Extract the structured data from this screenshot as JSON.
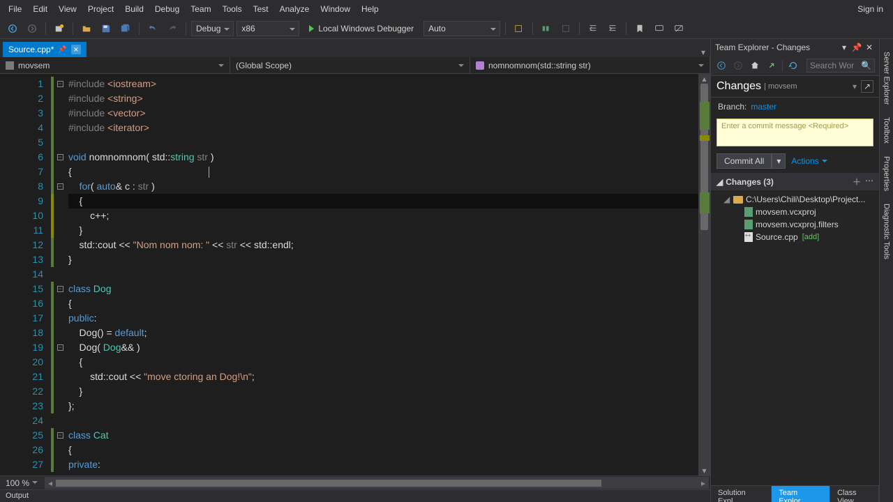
{
  "menu": {
    "items": [
      "File",
      "Edit",
      "View",
      "Project",
      "Build",
      "Debug",
      "Team",
      "Tools",
      "Test",
      "Analyze",
      "Window",
      "Help"
    ],
    "signin": "Sign in"
  },
  "toolbar": {
    "configuration": "Debug",
    "platform": "x86",
    "debug_target": "Local Windows Debugger",
    "auto": "Auto"
  },
  "tab": {
    "name": "Source.cpp*",
    "close": "×"
  },
  "nav": {
    "project": "movsem",
    "scope": "(Global Scope)",
    "member": "nomnomnom(std::string str)"
  },
  "code": {
    "lines": [
      {
        "n": 1,
        "fold": "-",
        "ch": "sav",
        "html": "<span class='gray'>#include</span> <span class='str'>&lt;iostream&gt;</span>"
      },
      {
        "n": 2,
        "ch": "sav",
        "html": "<span class='gray'>#include</span> <span class='str'>&lt;string&gt;</span>"
      },
      {
        "n": 3,
        "ch": "sav",
        "html": "<span class='gray'>#include</span> <span class='str'>&lt;vector&gt;</span>"
      },
      {
        "n": 4,
        "ch": "sav",
        "html": "<span class='gray'>#include</span> <span class='str'>&lt;iterator&gt;</span>"
      },
      {
        "n": 5,
        "ch": "sav",
        "html": ""
      },
      {
        "n": 6,
        "fold": "-",
        "ch": "sav",
        "html": "<span class='kw'>void</span> nomnomnom( std::<span class='type'>string</span> <span class='gray'>str</span> )"
      },
      {
        "n": 7,
        "ch": "sav",
        "html": "{<span class='caret' style='margin-left:196px'></span>"
      },
      {
        "n": 8,
        "fold": "-",
        "ch": "sav",
        "html": "    <span class='kw'>for</span>( <span class='kw'>auto</span>&amp; c : <span class='gray'>str</span> )"
      },
      {
        "n": 9,
        "ch": "mod",
        "curr": true,
        "html": "    {"
      },
      {
        "n": 10,
        "ch": "mod",
        "html": "        c++;"
      },
      {
        "n": 11,
        "ch": "mod",
        "html": "    }"
      },
      {
        "n": 12,
        "ch": "sav",
        "html": "    std::cout &lt;&lt; <span class='str'>\"Nom nom nom: \"</span> &lt;&lt; <span class='gray'>str</span> &lt;&lt; std::endl;"
      },
      {
        "n": 13,
        "ch": "sav",
        "html": "}"
      },
      {
        "n": 14,
        "html": ""
      },
      {
        "n": 15,
        "fold": "-",
        "ch": "sav",
        "html": "<span class='kw'>class</span> <span class='type'>Dog</span>"
      },
      {
        "n": 16,
        "ch": "sav",
        "html": "{"
      },
      {
        "n": 17,
        "ch": "sav",
        "html": "<span class='kw'>public</span>:"
      },
      {
        "n": 18,
        "ch": "sav",
        "html": "    Dog() = <span class='kw'>default</span>;"
      },
      {
        "n": 19,
        "fold": "-",
        "ch": "sav",
        "html": "    Dog( <span class='type'>Dog</span>&amp;&amp; )"
      },
      {
        "n": 20,
        "ch": "sav",
        "html": "    {"
      },
      {
        "n": 21,
        "ch": "sav",
        "html": "        std::cout &lt;&lt; <span class='str'>\"move ctoring an Dog!\\n\"</span>;"
      },
      {
        "n": 22,
        "ch": "sav",
        "html": "    }"
      },
      {
        "n": 23,
        "ch": "sav",
        "html": "};"
      },
      {
        "n": 24,
        "html": ""
      },
      {
        "n": 25,
        "fold": "-",
        "ch": "sav",
        "html": "<span class='kw'>class</span> <span class='type'>Cat</span>"
      },
      {
        "n": 26,
        "ch": "sav",
        "html": "{"
      },
      {
        "n": 27,
        "ch": "sav",
        "html": "<span class='kw'>private</span>:"
      }
    ]
  },
  "zoom": "100 %",
  "team": {
    "title": "Team Explorer - Changes",
    "search_placeholder": "Search Wor",
    "heading": "Changes",
    "context": "movsem",
    "branch_label": "Branch:",
    "branch": "master",
    "commit_placeholder": "Enter a commit message <Required>",
    "commit_all": "Commit All",
    "actions": "Actions",
    "changes_header": "Changes (3)",
    "folder": "C:\\Users\\Chili\\Desktop\\Project...",
    "files": [
      {
        "name": "movsem.vcxproj",
        "type": "proj"
      },
      {
        "name": "movsem.vcxproj.filters",
        "type": "proj"
      },
      {
        "name": "Source.cpp",
        "type": "src",
        "add": "[add]"
      }
    ]
  },
  "right_tabs": [
    "Server Explorer",
    "Toolbox",
    "Properties",
    "Diagnostic Tools"
  ],
  "bottom_tabs": {
    "items": [
      "Solution Expl...",
      "Team Explor...",
      "Class View"
    ],
    "active": 1
  },
  "output": "Output"
}
